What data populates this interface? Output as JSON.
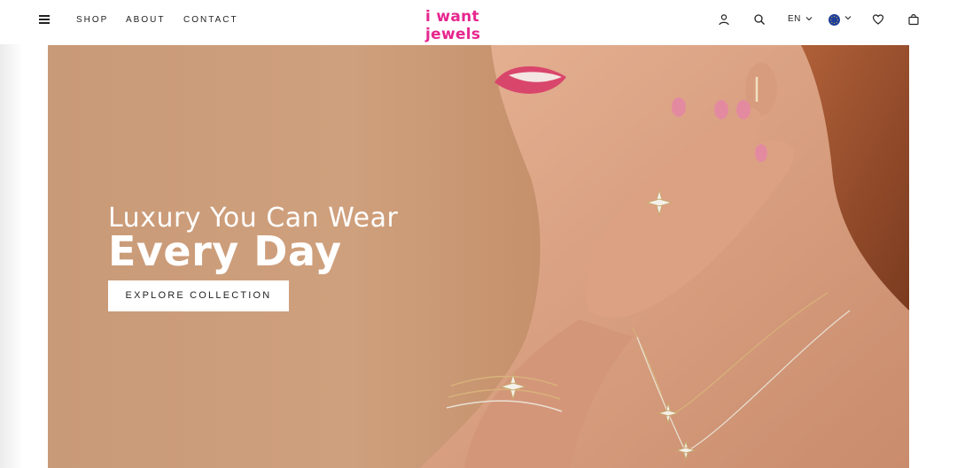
{
  "header": {
    "nav": [
      "SHOP",
      "ABOUT",
      "CONTACT"
    ],
    "logo": "i want jewels",
    "language": "EN",
    "colors": {
      "brand": "#e6268e",
      "flag": "#1f3f9b"
    },
    "icons": [
      "menu-icon",
      "user-icon",
      "search-icon",
      "chevron-down-icon",
      "eu-flag-icon",
      "heart-icon",
      "bag-icon"
    ]
  },
  "hero": {
    "line1": "Luxury You Can Wear",
    "line2": "Every Day",
    "cta": "EXPLORE COLLECTION"
  }
}
